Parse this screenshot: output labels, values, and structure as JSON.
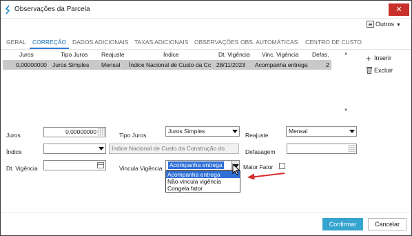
{
  "window": {
    "title": "Observações da Parcela",
    "close_label": "✕"
  },
  "toolbar": {
    "outros_label": "Outros"
  },
  "tabs": [
    {
      "label": "GERAL"
    },
    {
      "label": "CORREÇÃO",
      "active": true
    },
    {
      "label": "DADOS ADICIONAIS"
    },
    {
      "label": "TAXAS ADICIONAIS"
    },
    {
      "label": "OBSERVAÇÕES"
    },
    {
      "label": "OBS. AUTOMÁTICAS"
    },
    {
      "label": "CENTRO DE CUSTO"
    }
  ],
  "grid": {
    "columns": [
      "Juros",
      "Tipo Juros",
      "Reajuste",
      "Índice",
      "Dt. Vigência",
      "Vinc. Vigência",
      "Defas."
    ],
    "rows": [
      [
        "0,00000000",
        "Juros Simples",
        "Mensal",
        "Índice Nacional de Custo da Cc",
        "28/11/2023",
        "Acompanha entrega",
        "2"
      ]
    ]
  },
  "side_buttons": {
    "insert_label": "Inserir",
    "delete_label": "Excluir"
  },
  "form": {
    "juros_label": "Juros",
    "juros_value": "0,00000000",
    "tipo_juros_label": "Tipo Juros",
    "tipo_juros_value": "Juros Simples",
    "reajuste_label": "Reajuste",
    "reajuste_value": "Mensal",
    "indice_label": "Índice",
    "indice_value": "",
    "indice_desc": "Índice Nacional de Custo da Construção do",
    "defasagem_label": "Defasagem",
    "defasagem_value": "",
    "dt_vigencia_label": "Dt. Vigência",
    "dt_vigencia_value": "",
    "vincula_label": "Vincula Vigência",
    "vincula_value": "Acompanha entrega",
    "maior_fator_label": "Maior Fator",
    "maior_fator_checked": false
  },
  "vincula_options": [
    "Acompanha entrega",
    "Não vincula vigência",
    "Congela fator"
  ],
  "footer": {
    "confirm_label": "Confirmar",
    "cancel_label": "Cancelar"
  },
  "colors": {
    "accent": "#2f6fd6",
    "confirm": "#35a4cf",
    "close": "#c8302a",
    "annotation": "#d42a2a"
  }
}
